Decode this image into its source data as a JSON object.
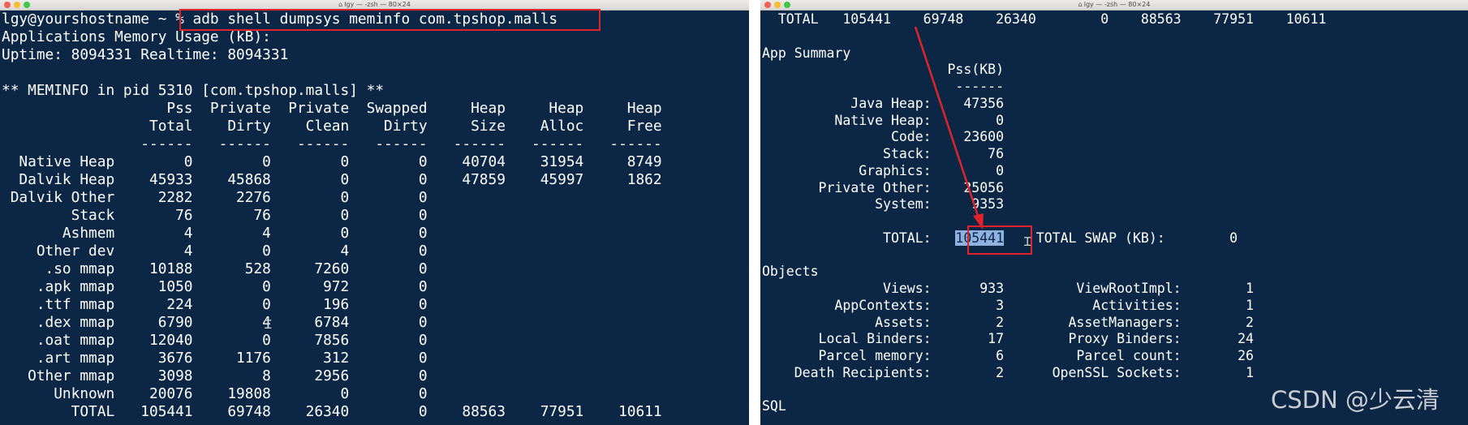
{
  "left_window": {
    "title": "lgy — -zsh — 80×24",
    "lines": [
      "lgy@yourshostname ~ % adb shell dumpsys meminfo com.tpshop.malls",
      "Applications Memory Usage (kB):",
      "Uptime: 8094331 Realtime: 8094331",
      "",
      "** MEMINFO in pid 5310 [com.tpshop.malls] **",
      "                   Pss  Private  Private  Swapped     Heap     Heap     Heap",
      "                 Total    Dirty    Clean    Dirty     Size    Alloc     Free",
      "                ------   ------   ------   ------   ------   ------   ------",
      "  Native Heap        0        0        0        0    40704    31954     8749",
      "  Dalvik Heap    45933    45868        0        0    47859    45997     1862",
      " Dalvik Other     2282     2276        0        0",
      "        Stack       76       76        0        0",
      "       Ashmem        4        4        0        0",
      "    Other dev        4        0        4        0",
      "     .so mmap    10188      528     7260        0",
      "    .apk mmap     1050        0      972        0",
      "    .ttf mmap      224        0      196        0",
      "    .dex mmap     6790        4     6784        0",
      "    .oat mmap    12040        0     7856        0",
      "    .art mmap     3676     1176      312        0",
      "   Other mmap     3098        8     2956        0",
      "      Unknown    20076    19808        0        0",
      "        TOTAL   105441    69748    26340        0    88563    77951    10611"
    ]
  },
  "right_window": {
    "title": "lgy — -zsh — 80×24",
    "lines": [
      "  TOTAL   105441    69748    26340        0    88563    77951    10611",
      "",
      "App Summary",
      "                       Pss(KB)",
      "                        ------",
      "           Java Heap:    47356",
      "         Native Heap:        0",
      "                Code:    23600",
      "               Stack:       76",
      "            Graphics:        0",
      "       Private Other:    25056",
      "              System:     9353",
      "",
      "               TOTAL:   ",
      "",
      "Objects",
      "               Views:      933         ViewRootImpl:        1",
      "         AppContexts:        3           Activities:        1",
      "              Assets:        2        AssetManagers:        2",
      "       Local Binders:       17        Proxy Binders:       24",
      "       Parcel memory:        6         Parcel count:       26",
      "    Death Recipients:        2      OpenSSL Sockets:        1",
      "",
      "SQL"
    ],
    "selected_total": "105441",
    "total_swap": "    TOTAL SWAP (KB):        0"
  },
  "watermark": "CSDN @少云清",
  "colors": {
    "terminal_bg": "#0b2745",
    "terminal_fg": "#ffffff",
    "highlight_box": "#e0232a",
    "arrow": "#e0232a",
    "selection": "#8fb1df"
  }
}
